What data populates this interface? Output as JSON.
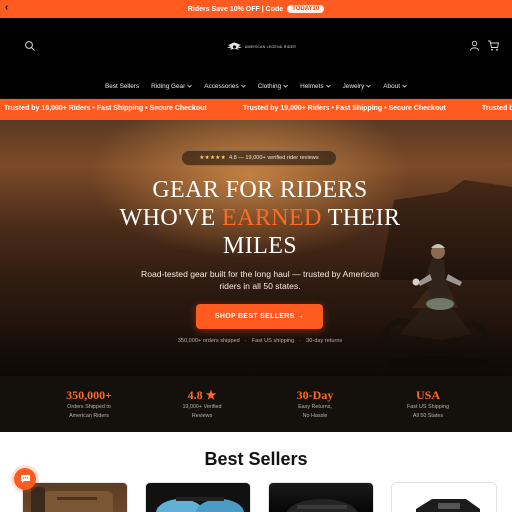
{
  "announcement": {
    "text": "Riders Save 10% OFF | Code",
    "code": "TODAY10",
    "prev_icon": "chevron-left-icon"
  },
  "header": {
    "logo_text": "AMERICAN LEGEND RIDER",
    "icons": [
      "search-icon",
      "account-icon",
      "cart-icon"
    ],
    "cart_count": "0"
  },
  "nav": {
    "items": [
      {
        "label": "Best Sellers",
        "dropdown": false
      },
      {
        "label": "Riding Gear",
        "dropdown": true
      },
      {
        "label": "Accessories",
        "dropdown": true
      },
      {
        "label": "Clothing",
        "dropdown": true
      },
      {
        "label": "Helmets",
        "dropdown": true
      },
      {
        "label": "Jewelry",
        "dropdown": true
      },
      {
        "label": "About",
        "dropdown": true
      }
    ]
  },
  "ticker": {
    "message": "Trusted by 19,000+ Riders • Fast Shipping • Secure Checkout"
  },
  "hero": {
    "badge_stars": "★★★★★",
    "badge_text": "4.8 — 19,000+ verified rider reviews",
    "headline_line1": "GEAR FOR RIDERS",
    "headline_pre": "WHO'VE ",
    "headline_accent": "EARNED",
    "headline_post": " THEIR",
    "headline_line3": "MILES",
    "subtitle": "Road-tested gear built for the long haul — trusted by American riders in all 50 states.",
    "cta_label": "SHOP BEST SELLERS →",
    "facts": [
      "350,000+ orders shipped",
      "·",
      "Fast US shipping",
      "·",
      "30-day returns"
    ]
  },
  "stats": [
    {
      "value": "350,000+",
      "label1": "Orders Shipped to",
      "label2": "American Riders"
    },
    {
      "value": "4.8 ★",
      "label1": "19,000+ Verified",
      "label2": "Reviews"
    },
    {
      "value": "30-Day",
      "label1": "Easy Returns,",
      "label2": "No Hassle"
    },
    {
      "value": "USA",
      "label1": "Fast US Shipping",
      "label2": "All 50 States"
    }
  ],
  "best_sellers": {
    "title": "Best Sellers"
  },
  "colors": {
    "accent": "#ff5a1f",
    "header_bg": "#000000",
    "stats_bg": "#14100c"
  },
  "chat": {
    "icon": "chat-bubble-icon"
  }
}
